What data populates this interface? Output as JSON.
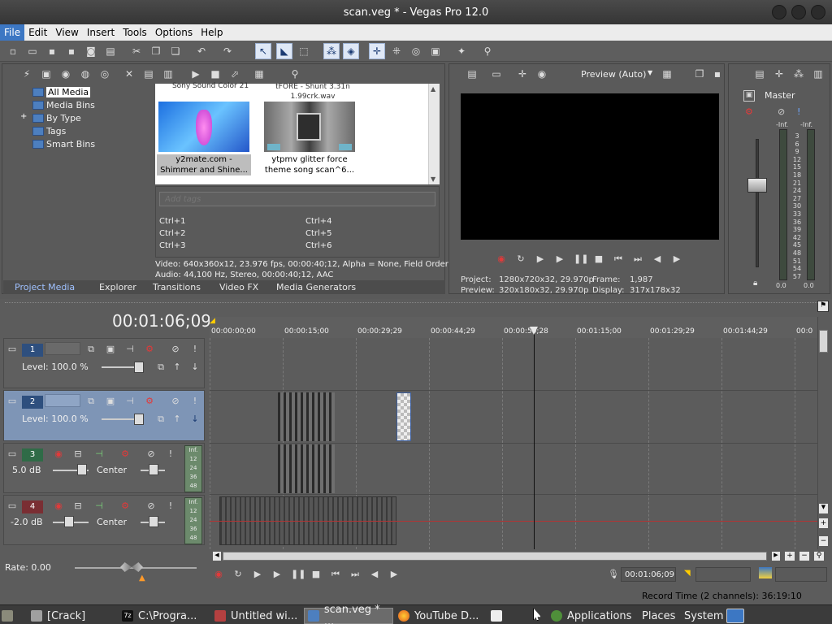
{
  "window": {
    "title": "scan.veg * - Vegas Pro 12.0"
  },
  "menu": [
    "File",
    "Edit",
    "View",
    "Insert",
    "Tools",
    "Options",
    "Help"
  ],
  "project_media": {
    "tree": [
      "All Media",
      "Media Bins",
      "By Type",
      "Tags",
      "Smart Bins"
    ],
    "top_captions": [
      "Sony Sound Color 21",
      "tFORE - Shunt 3.31n\n1.99crk.wav"
    ],
    "items": [
      {
        "caption": "y2mate.com -\nShimmer and Shine..."
      },
      {
        "caption": "ytpmv glitter force\ntheme song scan^6..."
      }
    ],
    "tags_placeholder": "Add tags",
    "shortcuts": [
      "Ctrl+1",
      "Ctrl+2",
      "Ctrl+3",
      "Ctrl+4",
      "Ctrl+5",
      "Ctrl+6"
    ],
    "info_video": "Video: 640x360x12, 23.976 fps, 00:00:40;12, Alpha = None, Field Order",
    "info_audio": "Audio: 44,100 Hz, Stereo, 00:00:40;12, AAC"
  },
  "tabs": [
    "Project Media",
    "Explorer",
    "Transitions",
    "Video FX",
    "Media Generators"
  ],
  "preview": {
    "mode": "Preview (Auto)",
    "project_label": "Project:",
    "project_value": "1280x720x32, 29.970p",
    "frame_label": "Frame:",
    "frame_value": "1,987",
    "preview_label": "Preview:",
    "preview_value": "320x180x32, 29.970p",
    "display_label": "Display:",
    "display_value": "317x178x32"
  },
  "master": {
    "label": "Master",
    "inf_left": "-Inf.",
    "inf_right": "-Inf.",
    "scale": [
      "3",
      "6",
      "9",
      "12",
      "15",
      "18",
      "21",
      "24",
      "27",
      "30",
      "33",
      "36",
      "39",
      "42",
      "45",
      "48",
      "51",
      "54",
      "57"
    ],
    "bottom_left": "0.0",
    "bottom_right": "0.0"
  },
  "timeline": {
    "timecode": "00:01:06;09",
    "ruler": [
      "00:00:00;00",
      "00:00:15;00",
      "00:00:29;29",
      "00:00:44;29",
      "00:00:59;28",
      "00:01:15;00",
      "00:01:29;29",
      "00:01:44;29",
      "00:0"
    ],
    "tracks": [
      {
        "num": "1",
        "type": "video",
        "level": "Level: 100.0 %"
      },
      {
        "num": "2",
        "type": "video",
        "level": "Level: 100.0 %"
      },
      {
        "num": "3",
        "type": "audio",
        "level": "5.0 dB",
        "pan": "Center",
        "meter": [
          "Inf.",
          "12",
          "24",
          "36",
          "48"
        ]
      },
      {
        "num": "4",
        "type": "audio",
        "level": "-2.0 dB",
        "pan": "Center",
        "meter": [
          "Inf.",
          "12",
          "24",
          "36",
          "48"
        ]
      }
    ]
  },
  "status": {
    "rate": "Rate: 0.00",
    "cursor_time": "00:01:06;09",
    "record_time": "Record Time (2 channels): 36:19:10"
  },
  "taskbar": {
    "tasks": [
      "[Crack]",
      "C:\\Progra...",
      "Untitled wi...",
      "scan.veg * ...",
      "YouTube D..."
    ],
    "menus": [
      "Applications",
      "Places",
      "System"
    ]
  },
  "colors": {
    "accent_blue": "#3c77c3",
    "track_selected": "#7e95b6",
    "video_track_num": "#2e4f7e",
    "audio3_num": "#2f6b47",
    "audio4_num": "#7a2e33"
  }
}
